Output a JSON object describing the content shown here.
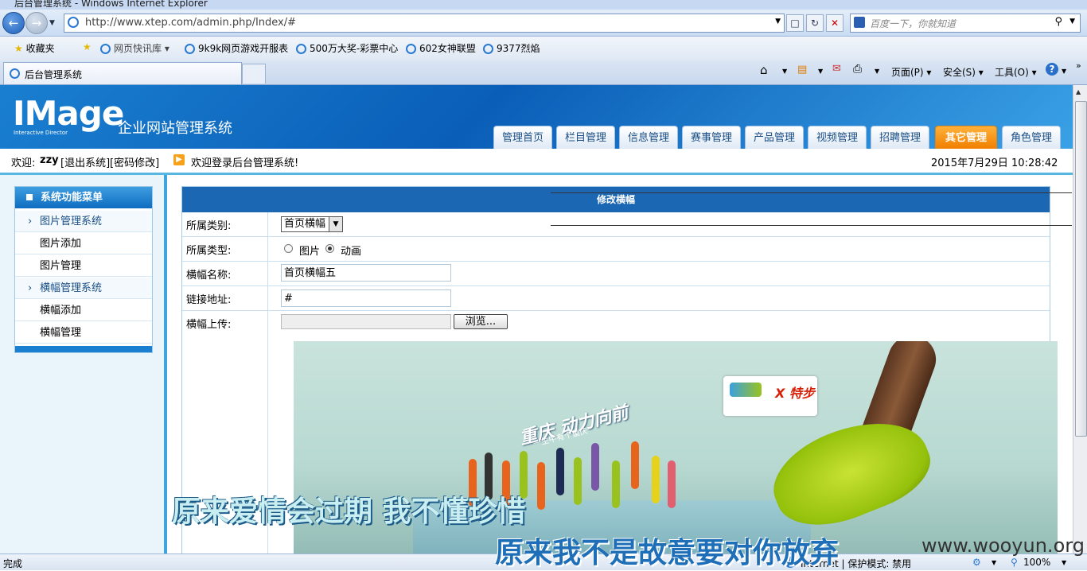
{
  "browser": {
    "window_title": "后台管理系统 - Windows Internet Explorer",
    "url": "http://www.xtep.com/admin.php/Index/#",
    "search_placeholder": "百度一下，你就知道",
    "favorites_label": "收藏夹",
    "favorites": [
      "网页快讯库 ▾",
      "9k9k网页游戏开服表",
      "500万大奖-彩票中心",
      "602女神联盟",
      "9377烈焰"
    ],
    "tab_title": "后台管理系统",
    "commands": [
      "页面(P) ▾",
      "安全(S) ▾",
      "工具(O) ▾"
    ],
    "status_left": "完成",
    "status_zone": "Internet | 保护模式: 禁用",
    "zoom": "100%"
  },
  "site": {
    "logo": "IMage",
    "logo_sub": "Interactive Director",
    "system_title": "企业网站管理系统",
    "nav_tabs": [
      {
        "label": "管理首页",
        "active": false
      },
      {
        "label": "栏目管理",
        "active": false
      },
      {
        "label": "信息管理",
        "active": false
      },
      {
        "label": "赛事管理",
        "active": false
      },
      {
        "label": "产品管理",
        "active": false
      },
      {
        "label": "视频管理",
        "active": false
      },
      {
        "label": "招聘管理",
        "active": false
      },
      {
        "label": "其它管理",
        "active": true
      },
      {
        "label": "角色管理",
        "active": false
      }
    ],
    "welcome_prefix": "欢迎:",
    "username": "zzy",
    "logout": "[退出系统]",
    "change_password": "[密码修改]",
    "notice": "欢迎登录后台管理系统!",
    "datetime": "2015年7月29日 10:28:42"
  },
  "sidebar": {
    "title": "系统功能菜单",
    "items": [
      {
        "label": "图片管理系统",
        "group": true
      },
      {
        "label": "图片添加",
        "group": false
      },
      {
        "label": "图片管理",
        "group": false
      },
      {
        "label": "横幅管理系统",
        "group": true
      },
      {
        "label": "横幅添加",
        "group": false
      },
      {
        "label": "横幅管理",
        "group": false
      }
    ]
  },
  "form": {
    "title": "修改横幅",
    "category_label": "所属类别:",
    "category_value": "首页横幅",
    "type_label": "所属类型:",
    "type_options": [
      "图片",
      "动画"
    ],
    "type_selected": "动画",
    "name_label": "横幅名称:",
    "name_value": "首页横幅五",
    "link_label": "链接地址:",
    "link_value": "#",
    "upload_label": "横幅上传:",
    "browse_label": "浏览..."
  },
  "banner": {
    "slogan": "重庆 动力向前",
    "slogan_sub": "一生中有个重庆",
    "brand": "X 特步"
  },
  "overlay": {
    "subtitle_1": "原来爱情会过期 我不懂珍惜",
    "subtitle_2": "原来我不是故意要对你放弃",
    "watermark": "www.wooyun.org"
  },
  "colors": {
    "nav_active": "#f07f00",
    "header_blue": "#0a5eb7",
    "form_head": "#1c67b3"
  }
}
